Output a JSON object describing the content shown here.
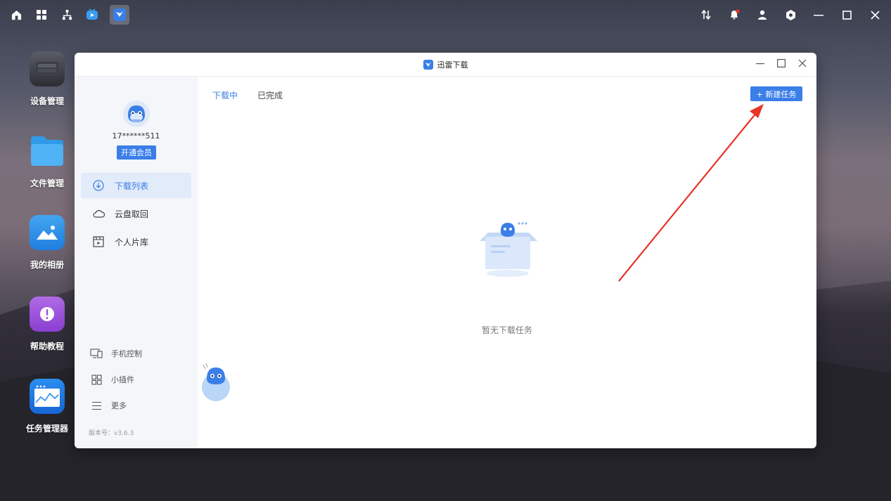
{
  "desktop": {
    "icons": [
      {
        "label": "设备管理",
        "icon": "device-icon"
      },
      {
        "label": "文件管理",
        "icon": "folder-icon"
      },
      {
        "label": "我的相册",
        "icon": "photo-icon"
      },
      {
        "label": "帮助教程",
        "icon": "help-icon"
      },
      {
        "label": "任务管理器",
        "icon": "task-manager-icon"
      }
    ]
  },
  "window": {
    "title": "迅雷下载",
    "user": {
      "username": "17******511",
      "vip_button": "开通会员"
    },
    "nav": [
      {
        "label": "下载列表",
        "icon": "download-list-icon",
        "active": true
      },
      {
        "label": "云盘取回",
        "icon": "cloud-icon",
        "active": false
      },
      {
        "label": "个人片库",
        "icon": "film-library-icon",
        "active": false
      }
    ],
    "bottom_nav": [
      {
        "label": "手机控制",
        "icon": "phone-control-icon"
      },
      {
        "label": "小插件",
        "icon": "plugin-icon"
      },
      {
        "label": "更多",
        "icon": "more-icon"
      }
    ],
    "version": "版本号：v3.6.3",
    "tabs": [
      {
        "label": "下载中",
        "active": true
      },
      {
        "label": "已完成",
        "active": false
      }
    ],
    "new_task_button": "+ 新建任务",
    "empty_text": "暂无下载任务"
  },
  "colors": {
    "accent": "#3a7ee8",
    "annotation_arrow": "#e8332a"
  }
}
